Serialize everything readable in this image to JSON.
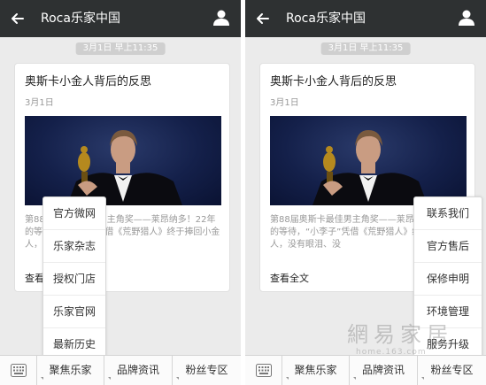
{
  "header": {
    "title": "Roca乐家中国"
  },
  "time_pill": "3月1日 早上11:35",
  "card": {
    "title": "奥斯卡小金人背后的反思",
    "date": "3月1日",
    "image_alt": "Oscar winner photo",
    "summary": "第88届奥斯卡最佳男主角奖——莱昂纳多！22年的等待，“小李子”凭借《荒野猎人》终于捧回小金人，没有眼泪、没",
    "link": "查看全文"
  },
  "bottom_tabs": [
    "聚焦乐家",
    "品牌资讯",
    "粉丝专区"
  ],
  "menu_left": [
    "官方微网",
    "乐家杂志",
    "授权门店",
    "乐家官网",
    "最新历史"
  ],
  "menu_right": [
    "联系我们",
    "官方售后",
    "保修申明",
    "环境管理",
    "服务升级"
  ],
  "watermark": {
    "big": "網易家居",
    "small": "home.163.com"
  },
  "colors": {
    "topbar": "#2e3132",
    "background": "#ebebeb"
  }
}
